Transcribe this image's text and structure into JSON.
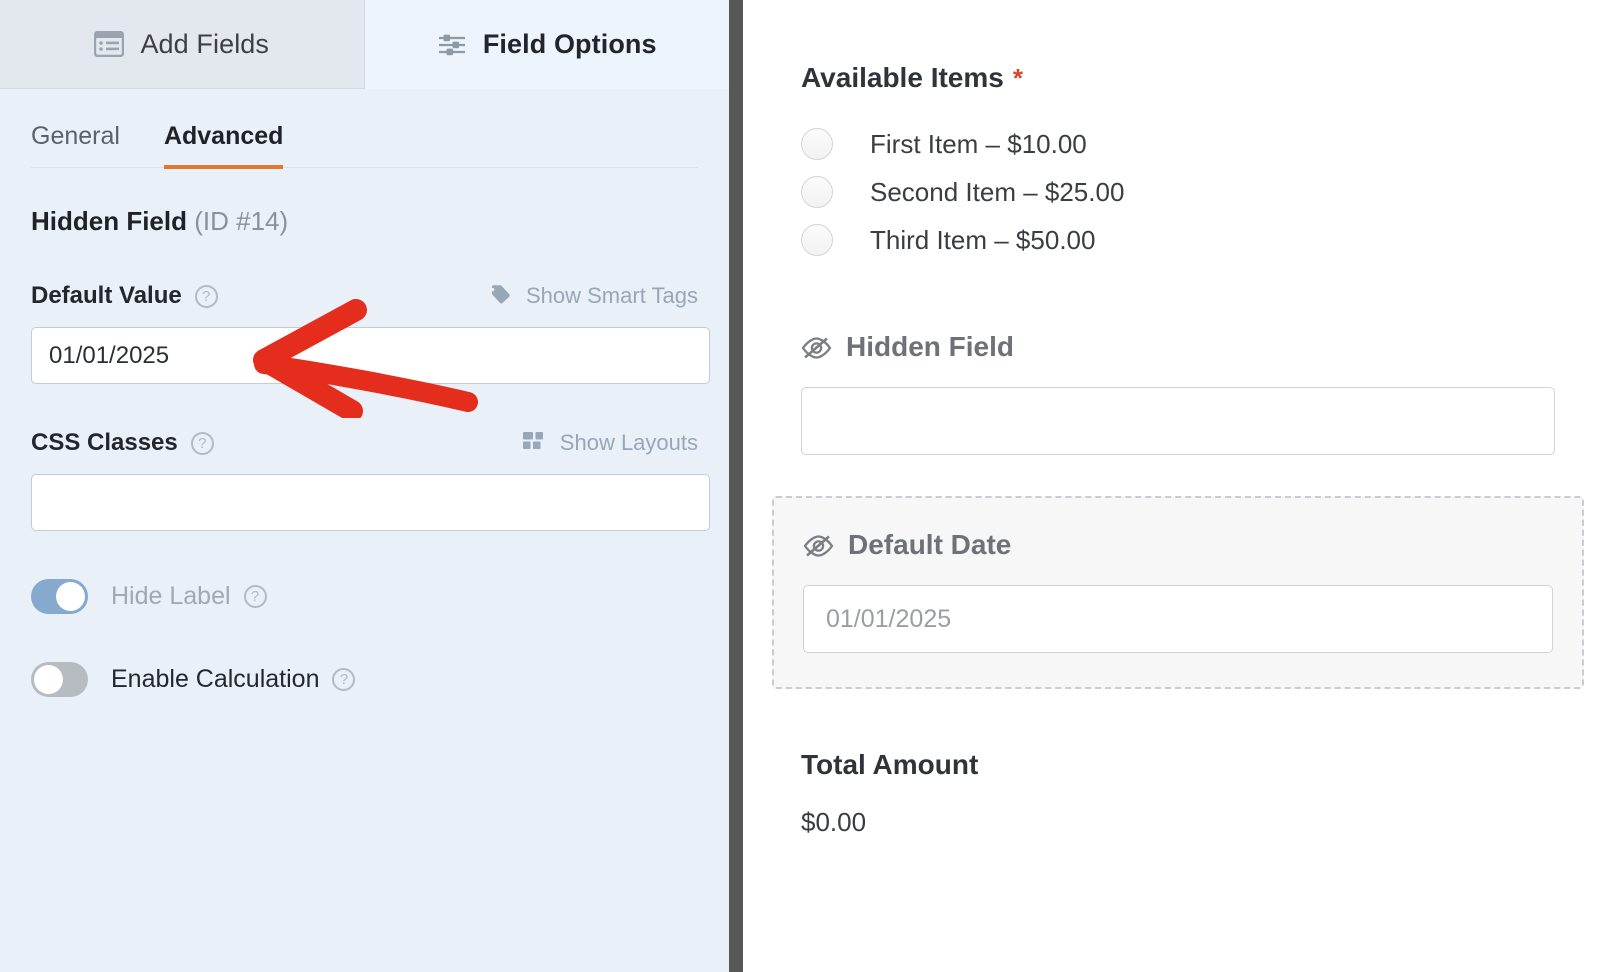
{
  "panel_tabs": [
    {
      "label": "Add Fields",
      "icon": "list-fields-icon",
      "active": false
    },
    {
      "label": "Field Options",
      "icon": "sliders-icon",
      "active": true
    }
  ],
  "sub_tabs": [
    {
      "label": "General",
      "active": false
    },
    {
      "label": "Advanced",
      "active": true
    }
  ],
  "field_options": {
    "field_name": "Hidden Field",
    "field_id": "(ID #14)",
    "default_value": {
      "label": "Default Value",
      "help_icon": "question-mark-icon",
      "action_label": "Show Smart Tags",
      "action_icon": "tag-icon",
      "value": "01/01/2025"
    },
    "css_classes": {
      "label": "CSS Classes",
      "help_icon": "question-mark-icon",
      "action_label": "Show Layouts",
      "action_icon": "grid-layout-icon",
      "value": ""
    },
    "toggles": [
      {
        "label": "Hide Label",
        "state": "on",
        "disabled": true,
        "help_icon": "question-mark-icon"
      },
      {
        "label": "Enable Calculation",
        "state": "off",
        "disabled": false,
        "help_icon": "question-mark-icon"
      }
    ]
  },
  "preview": {
    "available_items": {
      "label": "Available Items",
      "required_marker": "*",
      "options": [
        "First Item – $10.00",
        "Second Item – $25.00",
        "Third Item – $50.00"
      ]
    },
    "hidden_field": {
      "label": "Hidden Field",
      "icon": "eye-slash-icon",
      "value": ""
    },
    "default_date": {
      "label": "Default Date",
      "icon": "eye-slash-icon",
      "value": "01/01/2025"
    },
    "total_amount": {
      "label": "Total Amount",
      "value": "$0.00"
    }
  },
  "annotation": {
    "type": "arrow",
    "color": "#e42d1d",
    "points_to": "default-value-input"
  },
  "colors": {
    "panel_bg": "#e9f0f8",
    "tab_active_underline": "#e27730",
    "toggle_on": "#86a9ce",
    "toggle_off": "#b7bcc2",
    "required_star": "#d9432b",
    "divider": "#585858",
    "annotation_red": "#e42d1d"
  }
}
